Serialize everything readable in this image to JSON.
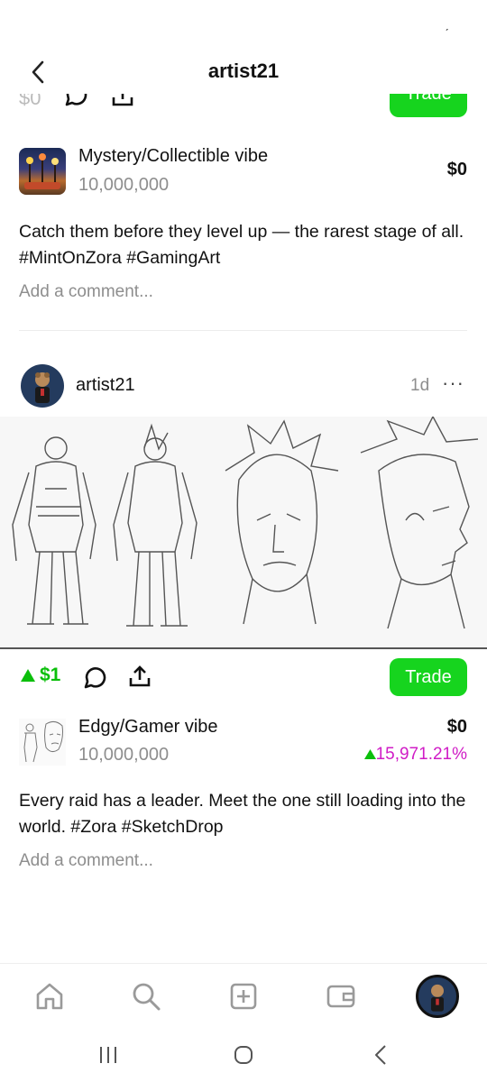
{
  "header": {
    "title": "artist21",
    "status_mark": "ˏ"
  },
  "prev_post": {
    "price_partial": "$0",
    "trade_label": "Trade",
    "coin": {
      "name": "Mystery/Collectible vibe",
      "supply": "10,000,000",
      "value": "$0"
    },
    "caption": "Catch them before they level up — the rarest stage of all. #MintOnZora #GamingArt",
    "comment_placeholder": "Add a comment..."
  },
  "post": {
    "author": "artist21",
    "time": "1d",
    "more": "···",
    "price_change": "$1",
    "trade_label": "Trade",
    "coin": {
      "name": "Edgy/Gamer vibe",
      "supply": "10,000,000",
      "value": "$0",
      "change": "15,971.21%"
    },
    "caption": "Every raid has a leader. Meet the one still loading into the world. #Zora #SketchDrop",
    "comment_placeholder": "Add a comment..."
  },
  "colors": {
    "trade_green": "#16d41e",
    "up_green": "#0bbf0b",
    "change_magenta": "#d01cc6"
  },
  "icons": [
    "back-arrow-icon",
    "comment-icon",
    "share-icon",
    "home-icon",
    "search-icon",
    "create-icon",
    "wallet-icon",
    "profile-avatar",
    "recents-icon",
    "home-gesture-icon",
    "system-back-icon"
  ]
}
